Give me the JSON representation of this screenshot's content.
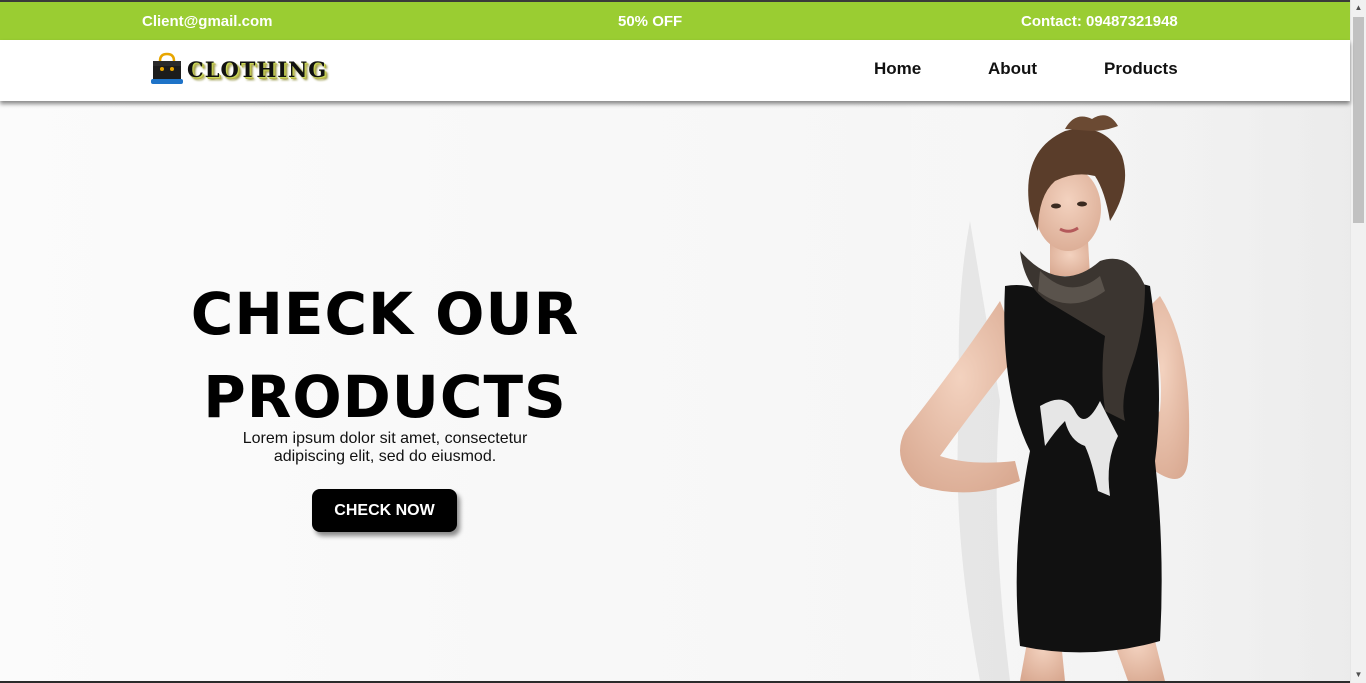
{
  "topbar": {
    "email": "Client@gmail.com",
    "promo": "50% OFF",
    "contact": "Contact: 09487321948"
  },
  "brand": {
    "logo_text": "CLOTHING",
    "logo_icon": "shopping-bag-icon"
  },
  "nav": {
    "items": [
      {
        "label": "Home"
      },
      {
        "label": "About"
      },
      {
        "label": "Products"
      }
    ]
  },
  "hero": {
    "title_line1": "CHECK OUR",
    "title_line2": "PRODUCTS",
    "subtitle_line1": "Lorem ipsum dolor sit amet, consectetur",
    "subtitle_line2": "adipiscing elit, sed do eiusmod.",
    "button_label": "CHECK NOW"
  },
  "colors": {
    "accent": "#9acd32",
    "button": "#000000",
    "text_on_accent": "#ffffff"
  }
}
